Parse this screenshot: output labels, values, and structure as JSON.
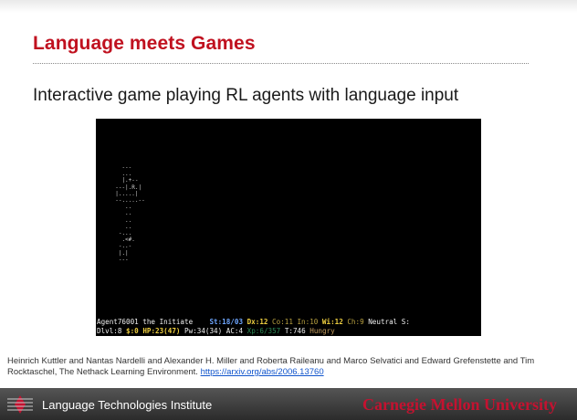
{
  "slide": {
    "title": "Language meets Games",
    "subtitle": "Interactive game playing RL agents with language input"
  },
  "game": {
    "map_lines": [
      "    ---",
      "    ...",
      "    |.+--",
      "  ---|.R.|",
      "  |.....|",
      "  --.....--",
      "     ..",
      "     ..",
      "     ..",
      "     ..",
      "   -...",
      "    .<#.",
      "   -..-",
      "   |.|",
      "   ---"
    ],
    "status_line1": {
      "name": "Agent76001 the Initiate",
      "st": "St:18/03",
      "dx": "Dx:12",
      "co": "Co:11",
      "in": "In:10",
      "wi": "Wi:12",
      "ch": "Ch:9",
      "align": "Neutral S:"
    },
    "status_line2": {
      "dlvl": "Dlvl:8",
      "gold": "$:0",
      "hp": "HP:23(47)",
      "pw": "Pw:34(34)",
      "ac": "AC:4",
      "xp": "Xp:6/357",
      "turn": "T:746",
      "hunger": "Hungry"
    }
  },
  "citation": {
    "text": "Heinrich Kuttler and Nantas Nardelli and Alexander H. Miller and Roberta Raileanu and Marco Selvatici and Edward Grefenstette and Tim Rocktaschel, The Nethack Learning Environment. ",
    "link": "https://arxiv.org/abs/2006.13760"
  },
  "footer": {
    "institute": "Language Technologies Institute",
    "university": "Carnegie Mellon University"
  },
  "colors": {
    "title": "#c0111f",
    "cmu_red": "#c41230",
    "link": "#1155cc",
    "stat_blue": "#6ea6ff",
    "stat_yellow": "#f0d040",
    "stat_olive": "#b8a040",
    "stat_green": "#2e8b57",
    "stat_tan": "#c8a060"
  }
}
